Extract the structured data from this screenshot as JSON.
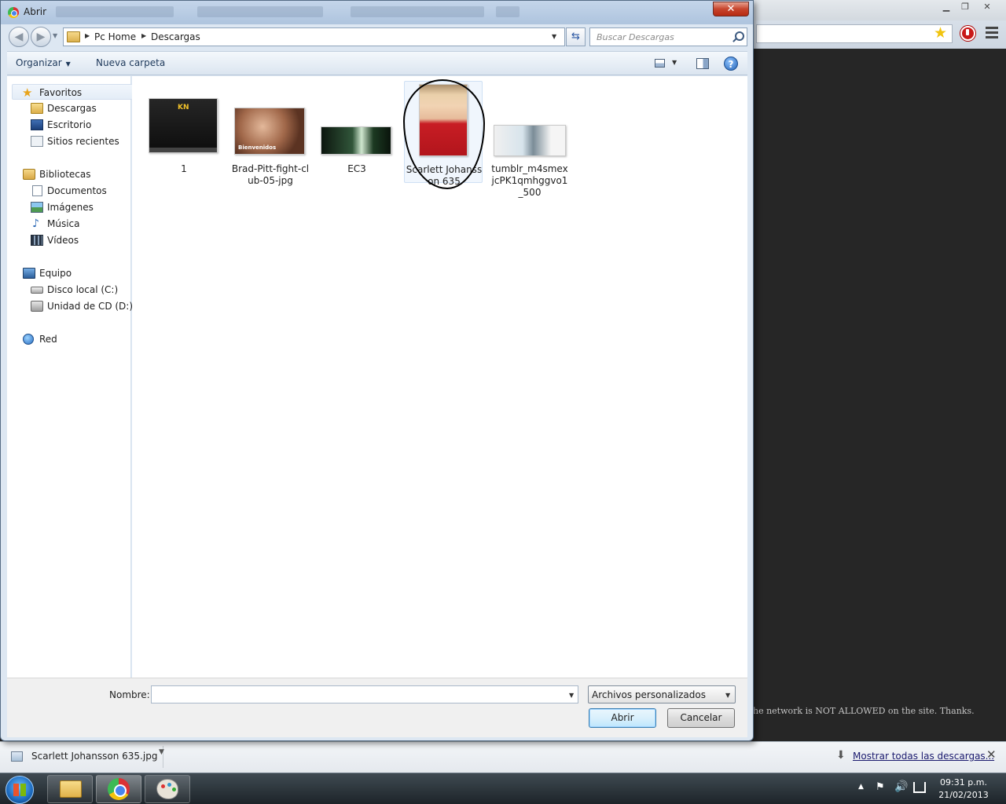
{
  "dialog": {
    "title": "Abrir",
    "close_label": "✕",
    "address": {
      "crumbs": [
        "Pc Home",
        "Descargas"
      ]
    },
    "search": {
      "placeholder": "Buscar Descargas"
    },
    "toolbar": {
      "organize_label": "Organizar",
      "new_folder_label": "Nueva carpeta",
      "help_label": "?"
    },
    "nav": {
      "favorites": {
        "label": "Favoritos",
        "items": [
          "Descargas",
          "Escritorio",
          "Sitios recientes"
        ]
      },
      "libraries": {
        "label": "Bibliotecas",
        "items": [
          "Documentos",
          "Imágenes",
          "Música",
          "Vídeos"
        ]
      },
      "computer": {
        "label": "Equipo",
        "items": [
          "Disco local (C:)",
          "Unidad de CD (D:)"
        ]
      },
      "network": {
        "label": "Red"
      }
    },
    "files": [
      {
        "name": "1"
      },
      {
        "name": "Brad-Pitt-fight-club-05-jpg",
        "thumb_caption": "Bienvenidos"
      },
      {
        "name": "EC3"
      },
      {
        "name": "Scarlett Johansson 635",
        "selected": true
      },
      {
        "name": "tumblr_m4smexjcPK1qmhggvo1_500"
      }
    ],
    "filename_label": "Nombre:",
    "filename_value": "",
    "filetype_value": "Archivos personalizados",
    "open_label": "Abrir",
    "cancel_label": "Cancelar"
  },
  "browser": {
    "page_notice": "he network is NOT ALLOWED on the site. Thanks.",
    "download_bar": {
      "file_name": "Scarlett Johansson 635.jpg",
      "show_all_label": "Mostrar todas las descargas..."
    }
  },
  "taskbar": {
    "clock_time": "09:31 p.m.",
    "clock_date": "21/02/2013"
  },
  "colors": {
    "dialog_frame": "#dde7f2",
    "close_button": "#c7452d",
    "page_background": "#262626",
    "selection": "#f0f6fd"
  }
}
